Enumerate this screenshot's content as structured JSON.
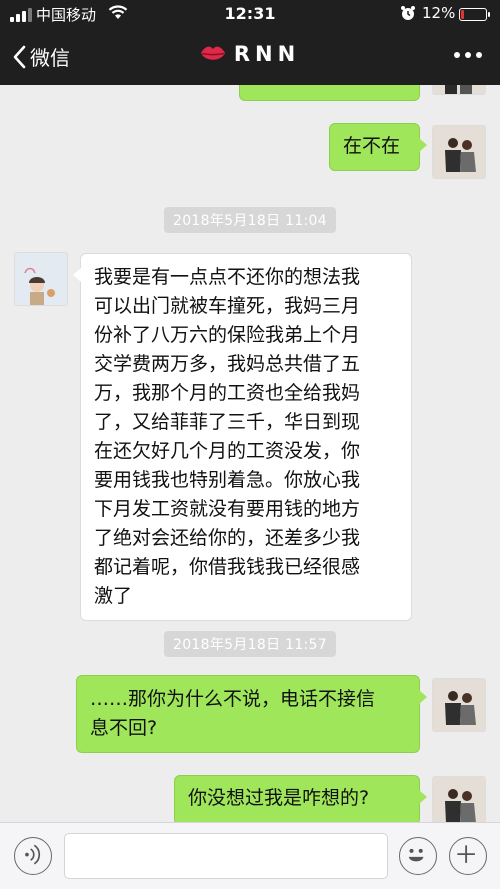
{
  "status_bar": {
    "carrier": "中国移动",
    "time": "12:31",
    "battery_percent": "12%",
    "battery_level": 0.12,
    "battery_color": "#e33333"
  },
  "nav": {
    "back_label": "微信",
    "chat_title": "RNN",
    "more_icon": "ellipsis-icon",
    "title_icon": "lips-icon"
  },
  "messages": [
    {
      "from": "me",
      "text": ""
    },
    {
      "from": "me",
      "text": "在不在"
    },
    {
      "timestamp": "2018年5月18日 11:04"
    },
    {
      "from": "friend",
      "lines": [
        "我要是有一点点不还你的想法我",
        "可以出门就被车撞死，我妈三月",
        "份补了八万六的保险我弟上个月",
        "交学费两万多，我妈总共借了五",
        "万，我那个月的工资也全给我妈",
        "了，又给菲菲了三千，华日到现",
        "在还欠好几个月的工资没发，你",
        "要用钱我也特别着急。你放心我",
        "下月发工资就没有要用钱的地方",
        "了绝对会还给你的，还差多少我",
        "都记着呢，你借我钱我已经很感",
        "激了"
      ]
    },
    {
      "timestamp": "2018年5月18日 11:57"
    },
    {
      "from": "me",
      "lines": [
        "……那你为什么不说，电话不接信",
        "息不回?"
      ]
    },
    {
      "from": "me",
      "text": "你没想过我是咋想的?"
    }
  ],
  "colors": {
    "outgoing_bubble": "#9fe65a",
    "incoming_bubble": "#ffffff",
    "header_bg": "#1f1f1f",
    "chat_bg": "#ededed"
  },
  "input_bar": {
    "voice_icon": "voice-icon",
    "emoji_icon": "emoji-icon",
    "add_icon": "plus-icon"
  }
}
